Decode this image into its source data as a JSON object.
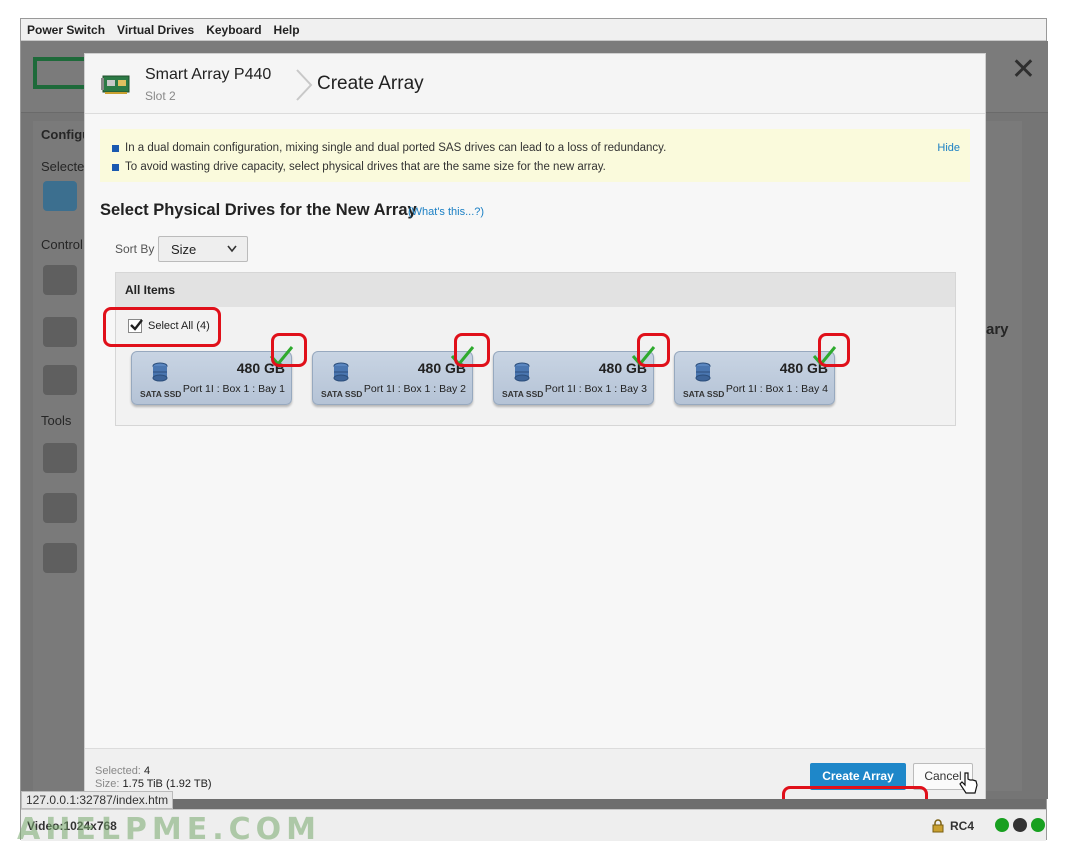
{
  "menubar": {
    "items": [
      "Power Switch",
      "Virtual Drives",
      "Keyboard",
      "Help"
    ]
  },
  "background": {
    "sidebar_texts": [
      "Configu",
      "Selecte",
      "Control",
      "Tools"
    ],
    "right_text": "ary"
  },
  "dialog": {
    "controller_name": "Smart Array P440",
    "controller_slot": "Slot 2",
    "title": "Create Array",
    "warnings": [
      "In a dual domain configuration, mixing single and dual ported SAS drives can lead to a loss of redundancy.",
      "To avoid wasting drive capacity, select physical drives that are the same size for the new array."
    ],
    "hide_label": "Hide",
    "section_title": "Select Physical Drives for the New Array",
    "whats_this": "(What's this...?)",
    "sort_label": "Sort By",
    "sort_value": "Size",
    "panel_title": "All Items",
    "select_all_label": "Select All (4)",
    "drives": [
      {
        "size": "480 GB",
        "type": "SATA SSD",
        "location": "Port 1I : Box 1 : Bay 1",
        "selected": true
      },
      {
        "size": "480 GB",
        "type": "SATA SSD",
        "location": "Port 1I : Box 1 : Bay 2",
        "selected": true
      },
      {
        "size": "480 GB",
        "type": "SATA SSD",
        "location": "Port 1I : Box 1 : Bay 3",
        "selected": true
      },
      {
        "size": "480 GB",
        "type": "SATA SSD",
        "location": "Port 1I : Box 1 : Bay 4",
        "selected": true
      }
    ],
    "footer": {
      "selected_label": "Selected:",
      "selected_value": "4",
      "size_label": "Size:",
      "size_value": "1.75 TiB (1.92 TB)"
    },
    "create_button": "Create Array",
    "cancel_button": "Cancel"
  },
  "statusbar": {
    "url_tooltip": "127.0.0.1:32787/index.htm",
    "video": "Video:1024x768",
    "watermark": "AHELPME.COM",
    "encryption": "RC4",
    "led_colors": [
      "#18a020",
      "#333333",
      "#18a020"
    ]
  },
  "colors": {
    "accent": "#1e87c9",
    "highlight": "#e0101a",
    "check": "#2eaa2e"
  }
}
